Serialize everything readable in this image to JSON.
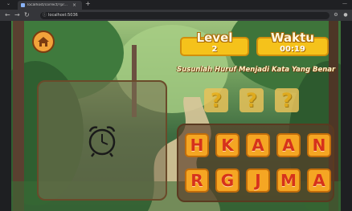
{
  "browser": {
    "tab_title": "localhost/correct/?pr...",
    "tab_close": "×",
    "new_tab": "+",
    "url": "localhost:5036"
  },
  "game": {
    "level_label": "Level",
    "level_value": "2",
    "time_label": "Waktu",
    "time_value": "00:19",
    "instruction": "Susunlah Huruf Menjadi Kata Yang Benar",
    "answer_slots": [
      "?",
      "?",
      "?"
    ],
    "letter_tiles": [
      "H",
      "K",
      "A",
      "A",
      "N",
      "R",
      "G",
      "J",
      "M",
      "A"
    ],
    "image_hint": "alarm-clock-icon"
  },
  "colors": {
    "stat_bg": "#f5c21b",
    "tile_bg": "#f5a623",
    "tile_text": "#d6321b",
    "home_btn": "#f2a33a"
  }
}
